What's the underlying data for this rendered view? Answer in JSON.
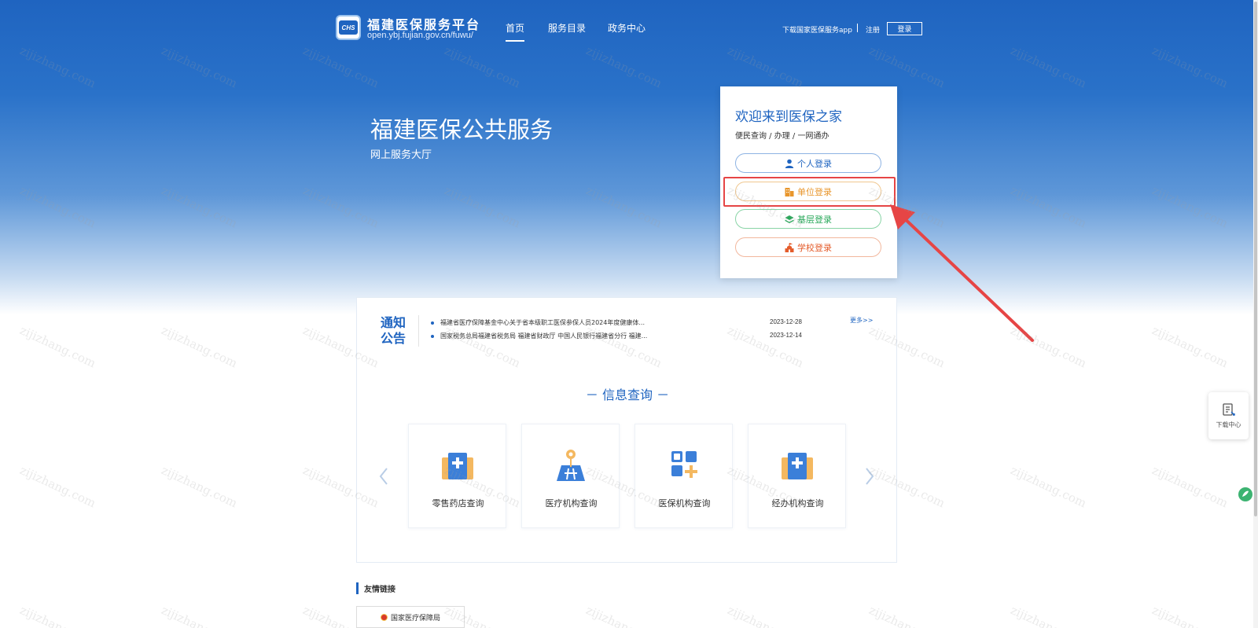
{
  "header": {
    "logo_text": "CHS",
    "site_title": "福建医保服务平台",
    "site_url": "open.ybj.fujian.gov.cn/fuwu/",
    "nav": [
      {
        "label": "首页",
        "active": true
      },
      {
        "label": "服务目录",
        "active": false
      },
      {
        "label": "政务中心",
        "active": false
      }
    ],
    "download_app_label": "下载国家医保服务app",
    "register_label": "注册",
    "login_label": "登录"
  },
  "hero": {
    "title": "福建医保公共服务",
    "subtitle": "网上服务大厅"
  },
  "login_card": {
    "title": "欢迎来到医保之家",
    "subtitle": "便民查询 / 办理 / 一网通办",
    "buttons": [
      {
        "label": "个人登录",
        "icon": "person-icon"
      },
      {
        "label": "单位登录",
        "icon": "building-icon"
      },
      {
        "label": "基层登录",
        "icon": "layers-icon"
      },
      {
        "label": "学校登录",
        "icon": "school-icon"
      }
    ]
  },
  "notices": {
    "label_line1": "通知",
    "label_line2": "公告",
    "more_label": "更多>>",
    "items": [
      {
        "text": "福建省医疗保障基金中心关于省本级职工医保参保人员2024年度健康体...",
        "date": "2023-12-28"
      },
      {
        "text": "国家税务总局福建省税务局 福建省财政厅 中国人民银行福建省分行 福建...",
        "date": "2023-12-14"
      }
    ]
  },
  "info_query": {
    "title": "－ 信息查询 －",
    "items": [
      {
        "label": "零售药店查询",
        "icon": "pharmacy-icon"
      },
      {
        "label": "医疗机构查询",
        "icon": "hospital-map-icon"
      },
      {
        "label": "医保机构查询",
        "icon": "grid-plus-icon"
      },
      {
        "label": "经办机构查询",
        "icon": "medical-box-icon"
      }
    ]
  },
  "friend_links": {
    "title": "友情链接",
    "items": [
      {
        "label": "国家医疗保障局"
      }
    ]
  },
  "side_float": {
    "download_center_label": "下载中心"
  },
  "watermark_text": "zijizhang.com",
  "colors": {
    "primary": "#1f64c0",
    "unit_orange": "#e8962c",
    "base_green": "#29a85a",
    "school_red": "#e45c2b",
    "highlight_red": "#e64545"
  }
}
